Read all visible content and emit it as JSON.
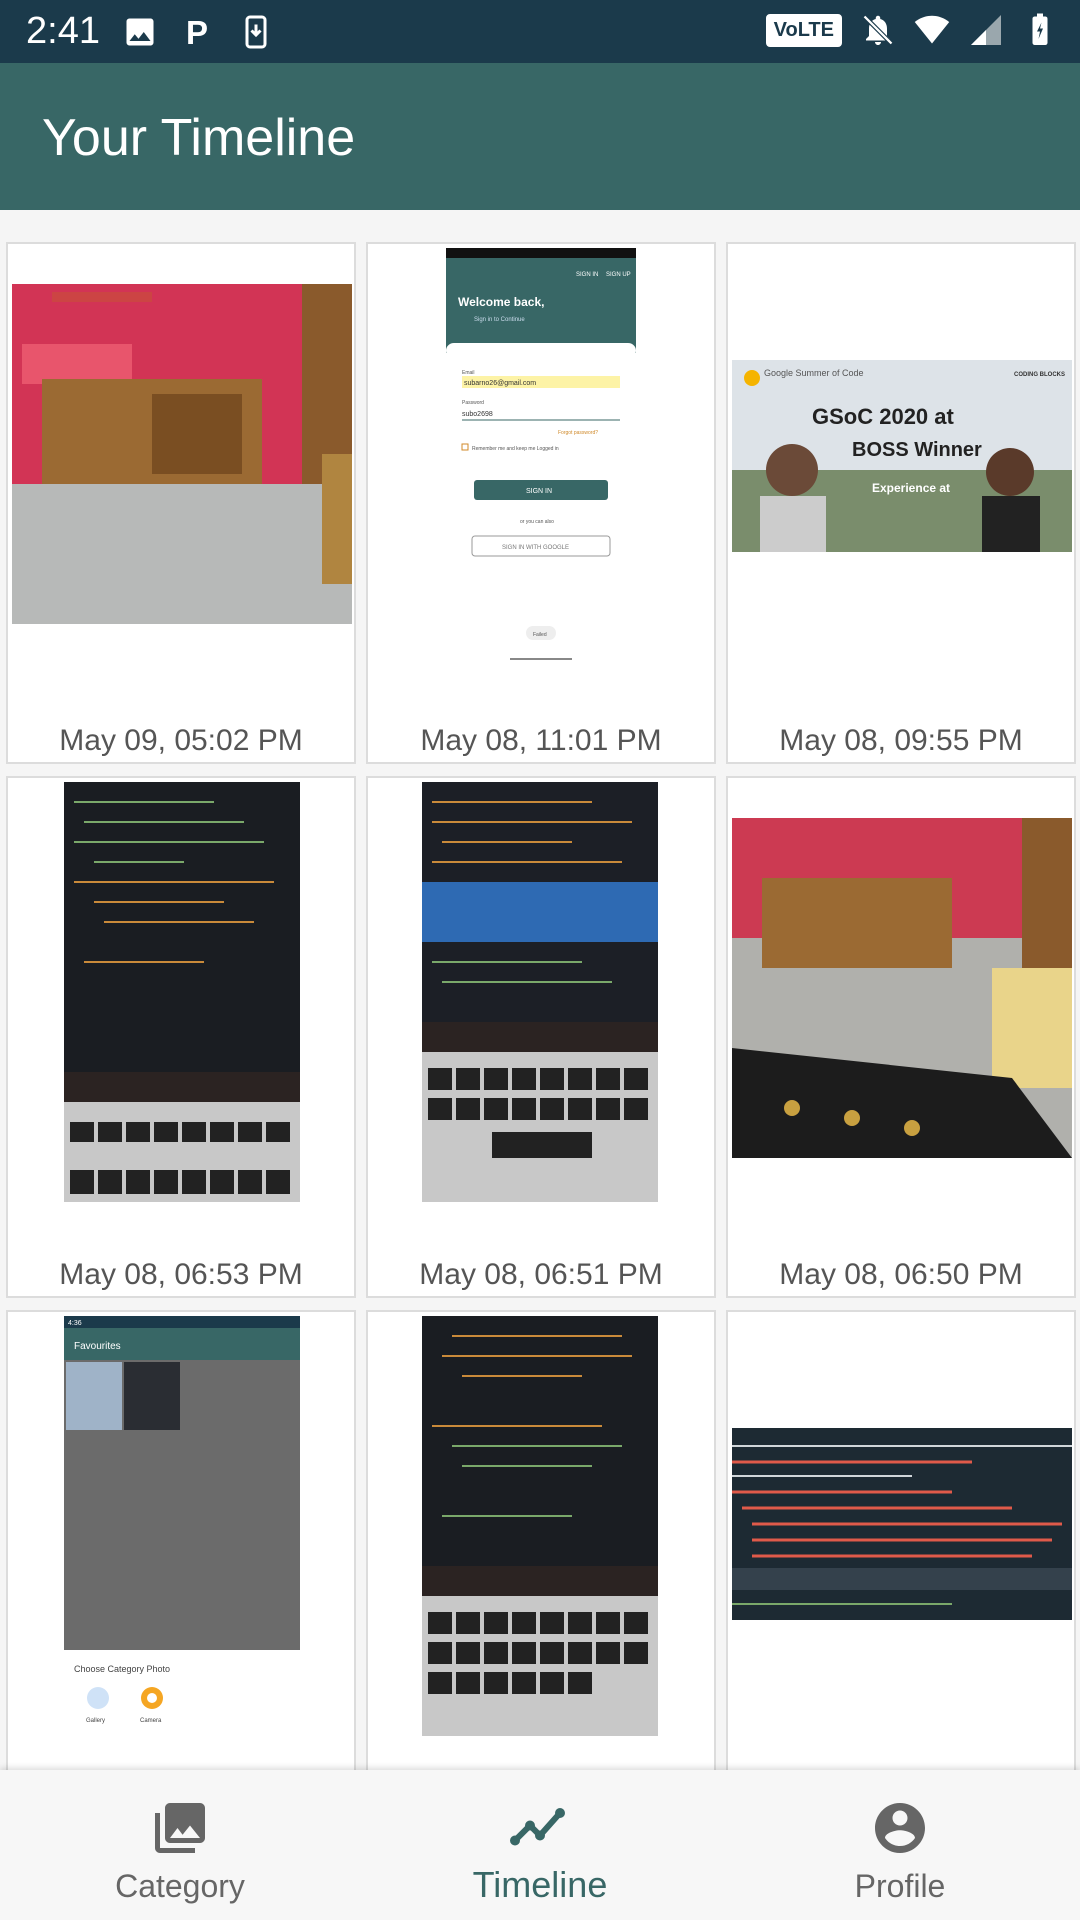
{
  "status_bar": {
    "time": "2:41",
    "network_badge": "VoLTE",
    "icons": [
      "image-icon",
      "p-app-icon",
      "download-icon",
      "mute-icon",
      "wifi-icon",
      "signal-icon",
      "battery-icon"
    ]
  },
  "app_bar": {
    "title": "Your Timeline"
  },
  "photos": [
    {
      "date": "May 09, 05:02 PM",
      "content": "room photo"
    },
    {
      "date": "May 08, 11:01 PM",
      "content": "login screenshot"
    },
    {
      "date": "May 08, 09:55 PM",
      "content": "GSoC banner"
    },
    {
      "date": "May 08, 06:53 PM",
      "content": "laptop code photo"
    },
    {
      "date": "May 08, 06:51 PM",
      "content": "laptop code photo"
    },
    {
      "date": "May 08, 06:50 PM",
      "content": "room photo"
    },
    {
      "date": "",
      "content": "favourites screenshot"
    },
    {
      "date": "",
      "content": "laptop code photo"
    },
    {
      "date": "",
      "content": "terminal photo"
    }
  ],
  "screenshot_text": {
    "welcome": "Welcome back,",
    "signin_sub": "Sign in to Continue",
    "signin_tab": "SIGN IN",
    "signup_tab": "SIGN UP",
    "email_label": "Email",
    "email": "subarno26@gmail.com",
    "password_label": "Password",
    "password": "subo2698",
    "forgot": "Forgot password?",
    "remember": "Remember me and keep me Logged in",
    "signin_btn": "SIGN IN",
    "or": "or you can also",
    "google": "SIGN IN WITH GOOGLE",
    "failed": "Failed",
    "fav_time": "4:36",
    "fav_title": "Favourites",
    "choose": "Choose Category Photo",
    "gallery": "Gallery",
    "camera": "Camera",
    "gsoc_org": "Google Summer of Code",
    "gsoc_title": "GSoC 2020 at",
    "gsoc_sub": "BOSS Winner",
    "gsoc_exp": "Experience at",
    "coding_blocks": "CODING BLOCKS"
  },
  "bottom_nav": {
    "items": [
      {
        "label": "Category",
        "icon": "photo-library-icon",
        "active": false
      },
      {
        "label": "Timeline",
        "icon": "timeline-icon",
        "active": true
      },
      {
        "label": "Profile",
        "icon": "account-circle-icon",
        "active": false
      }
    ]
  },
  "colors": {
    "status_bar": "#1b3a4b",
    "app_bar": "#386766",
    "active_nav": "#386766"
  }
}
